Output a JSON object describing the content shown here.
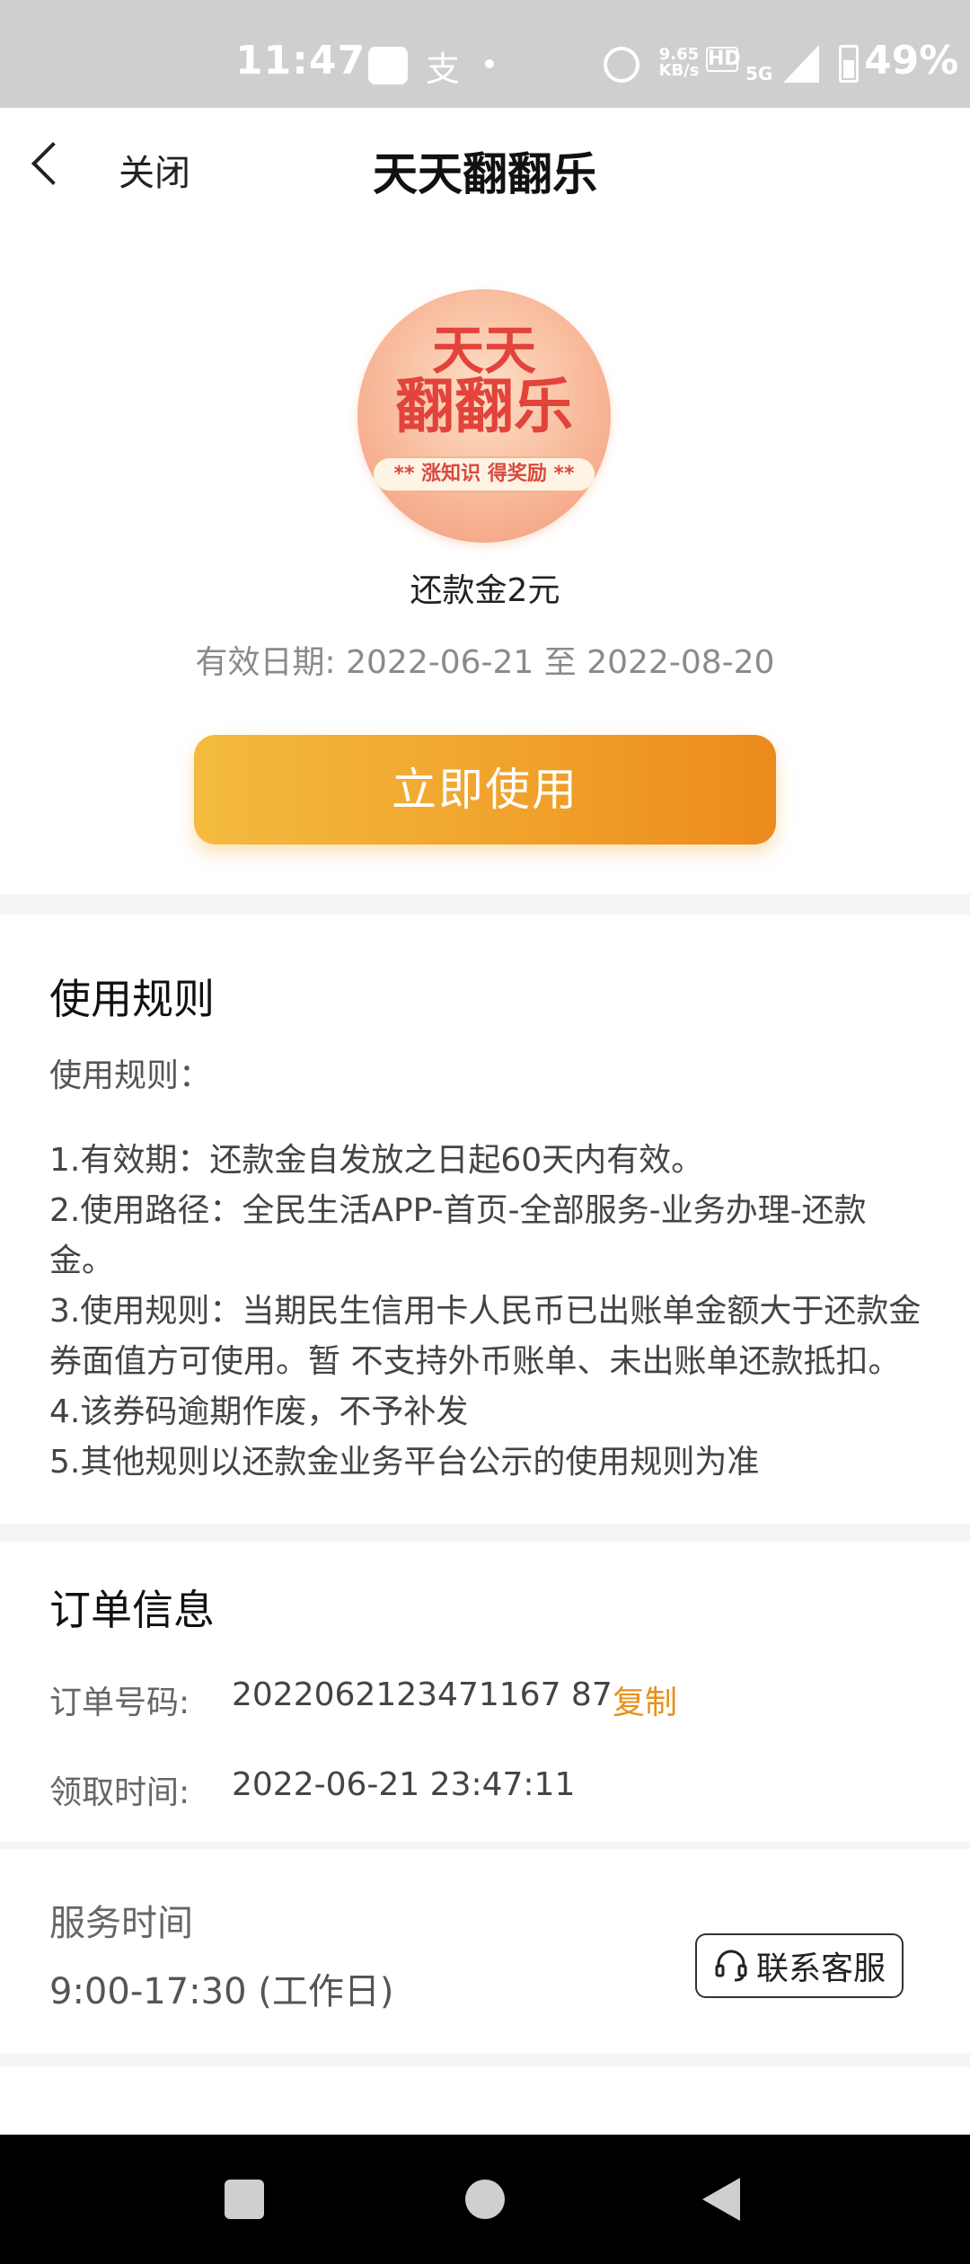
{
  "status_bar": {
    "time": "11:47",
    "alipay_glyph": "支",
    "net_speed": "9.65 KB/s",
    "hd_label": "HD",
    "network": "5G",
    "battery": "49%"
  },
  "nav": {
    "close_label": "关闭",
    "title": "天天翻翻乐"
  },
  "coupon": {
    "badge_line1": "天天",
    "badge_line2": "翻翻乐",
    "badge_slogan": "** 涨知识 得奖励 **",
    "name": "还款金2元",
    "validity": "有效日期: 2022-06-21 至 2022-08-20",
    "use_button": "立即使用"
  },
  "rules": {
    "title": "使用规则",
    "subtitle": "使用规则：",
    "lines": [
      "1.有效期：还款金自发放之日起60天内有效。",
      "2.使用路径：全民生活APP-首页-全部服务-业务办理-还款金。",
      "3.使用规则：当期民生信用卡人民币已出账单金额大于还款金券面值方可使用。暂 不支持外币账单、未出账单还款抵扣。 4.该券码逾期作废，不予补发",
      "5.其他规则以还款金业务平台公示的使用规则为准"
    ]
  },
  "order": {
    "title": "订单信息",
    "number_label": "订单号码:",
    "number_value": "2022062123471167 87",
    "copy_label": "复制",
    "time_label": "领取时间:",
    "time_value": "2022-06-21 23:47:11"
  },
  "service": {
    "label": "服务时间",
    "hours": "9:00-17:30 (工作日)",
    "contact_button": "联系客服"
  },
  "colors": {
    "accent_orange": "#f0a02a",
    "copy_orange": "#e9901a",
    "badge_red": "#e2433a"
  }
}
